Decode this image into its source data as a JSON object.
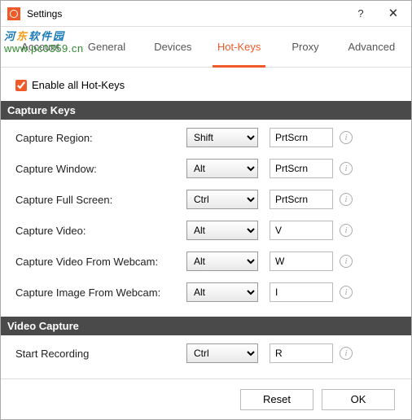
{
  "window": {
    "title": "Settings",
    "help": "?",
    "close": "🗙"
  },
  "watermark": {
    "line1_a": "河",
    "line1_b": "东",
    "line1_c": "软件园",
    "line2": "www.pc0359.cn"
  },
  "tabs": [
    {
      "label": "Account"
    },
    {
      "label": "General"
    },
    {
      "label": "Devices"
    },
    {
      "label": "Hot-Keys"
    },
    {
      "label": "Proxy"
    },
    {
      "label": "Advanced"
    }
  ],
  "enable": {
    "label": "Enable all Hot-Keys"
  },
  "sections": {
    "capture": "Capture Keys",
    "video": "Video Capture"
  },
  "hotkeys": [
    {
      "label": "Capture Region:",
      "mod": "Shift",
      "key": "PrtScrn"
    },
    {
      "label": "Capture Window:",
      "mod": "Alt",
      "key": "PrtScrn"
    },
    {
      "label": "Capture Full Screen:",
      "mod": "Ctrl",
      "key": "PrtScrn"
    },
    {
      "label": "Capture Video:",
      "mod": "Alt",
      "key": "V"
    },
    {
      "label": "Capture Video From Webcam:",
      "mod": "Alt",
      "key": "W"
    },
    {
      "label": "Capture Image From Webcam:",
      "mod": "Alt",
      "key": "I"
    }
  ],
  "video": [
    {
      "label": "Start Recording",
      "mod": "Ctrl",
      "key": "R"
    }
  ],
  "footer": {
    "reset": "Reset",
    "ok": "OK"
  }
}
